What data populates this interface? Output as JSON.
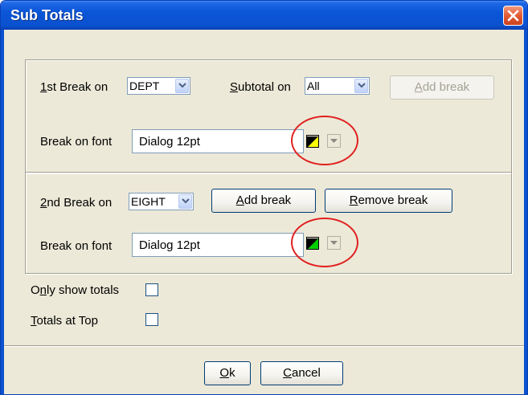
{
  "window": {
    "title": "Sub Totals"
  },
  "break1": {
    "label_prefix": "1",
    "label_rest": "st Break on",
    "combo_value": "DEPT",
    "subtotal_label_u": "S",
    "subtotal_label_rest": "ubtotal on",
    "subtotal_value": "All",
    "add_break_u": "A",
    "add_break_rest": "dd break",
    "font_label": "Break on font",
    "font_value": "Dialog 12pt",
    "swatch_color": "#ffff00"
  },
  "break2": {
    "label_prefix": "2",
    "label_rest": "nd Break on",
    "combo_value": "EIGHT",
    "add_break_u": "A",
    "add_break_rest": "dd break",
    "remove_break_u": "R",
    "remove_break_rest": "emove break",
    "font_label": "Break on font",
    "font_value": "Dialog 12pt",
    "swatch_color": "#00d000"
  },
  "options": {
    "only_totals_prefix": "O",
    "only_totals_u": "n",
    "only_totals_rest": "ly show totals",
    "totals_top_u": "T",
    "totals_top_rest": "otals at Top"
  },
  "footer": {
    "ok_u": "O",
    "ok_rest": "k",
    "cancel_u": "C",
    "cancel_rest": "ancel"
  },
  "colors": {
    "titlebar": "#0a56d8",
    "highlight_circle": "#e02020"
  },
  "icons": [
    "close-icon",
    "chevron-down-icon",
    "triangle-down-icon"
  ]
}
